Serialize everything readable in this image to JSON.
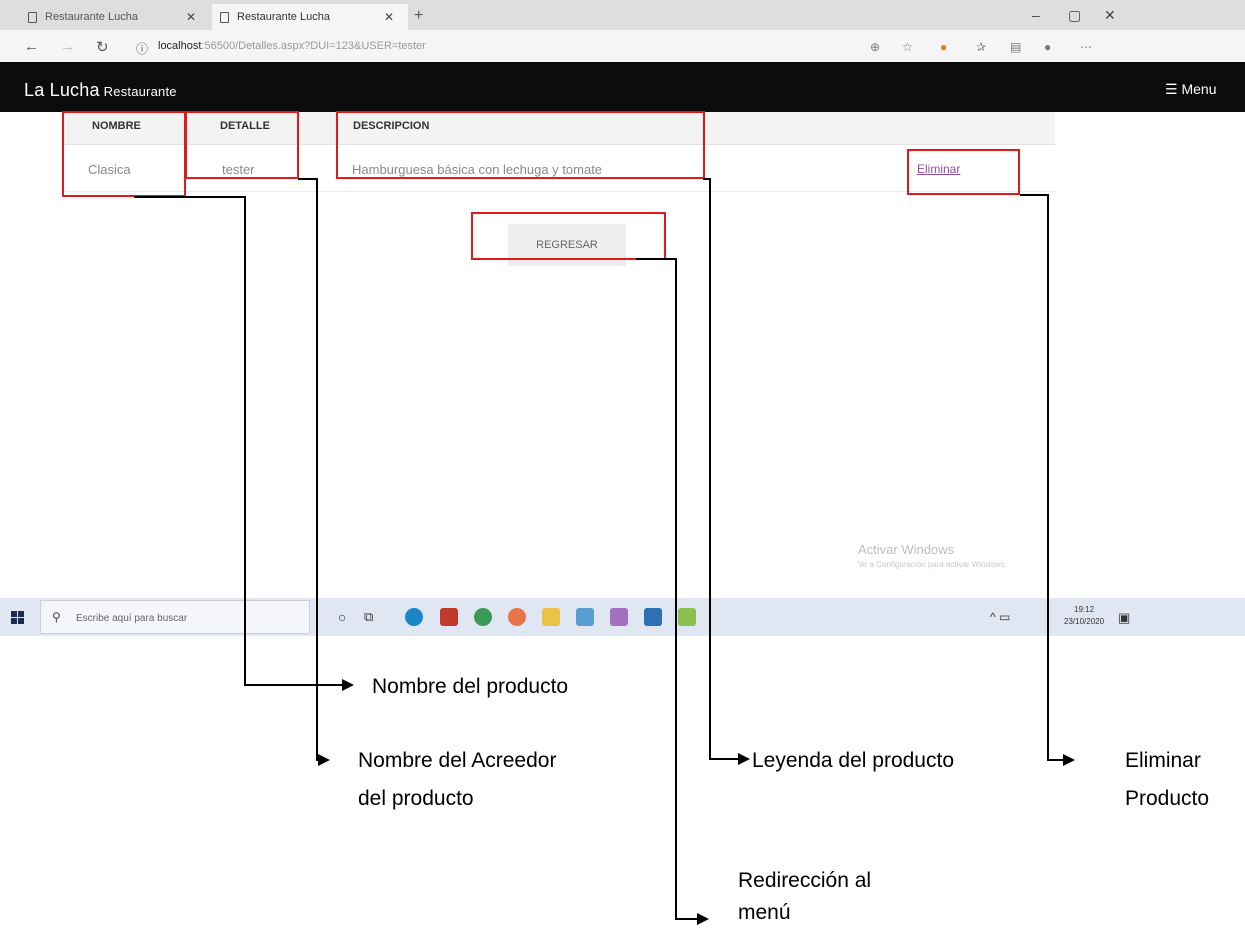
{
  "browser": {
    "tabs": [
      {
        "label": "Restaurante Lucha"
      },
      {
        "label": "Restaurante Lucha"
      }
    ],
    "url_host": "localhost",
    "url_rest": ":56500/Detalles.aspx?DUI=123&USER=tester"
  },
  "site": {
    "brand": "La Lucha",
    "brand_sub": "Restaurante",
    "menu_label": "Menu"
  },
  "table": {
    "headers": [
      "NOMBRE",
      "DETALLE",
      "DESCRIPCION"
    ],
    "row": {
      "nombre": "Clasica",
      "detalle": "tester",
      "descripcion": "Hamburguesa básica con lechuga y tomate",
      "action": "Eliminar"
    }
  },
  "back_button": "REGRESAR",
  "watermark": {
    "title": "Activar Windows",
    "subtitle": "Ve a Configuración para activar Windows."
  },
  "taskbar": {
    "search_placeholder": "Escribe aquí para buscar",
    "time": "19:12",
    "date": "23/10/2020"
  },
  "annotations": {
    "nombre": "Nombre del producto",
    "acreedor_1": "Nombre del Acreedor",
    "acreedor_2": "del producto",
    "leyenda": "Leyenda del producto",
    "eliminar_1": "Eliminar",
    "eliminar_2": "Producto",
    "redir_1": "Redirección al",
    "redir_2": "menú"
  },
  "colors": {
    "annotation_box": "#e0191b",
    "header_bg": "#0c0c0c",
    "link": "#8f4fa1"
  }
}
